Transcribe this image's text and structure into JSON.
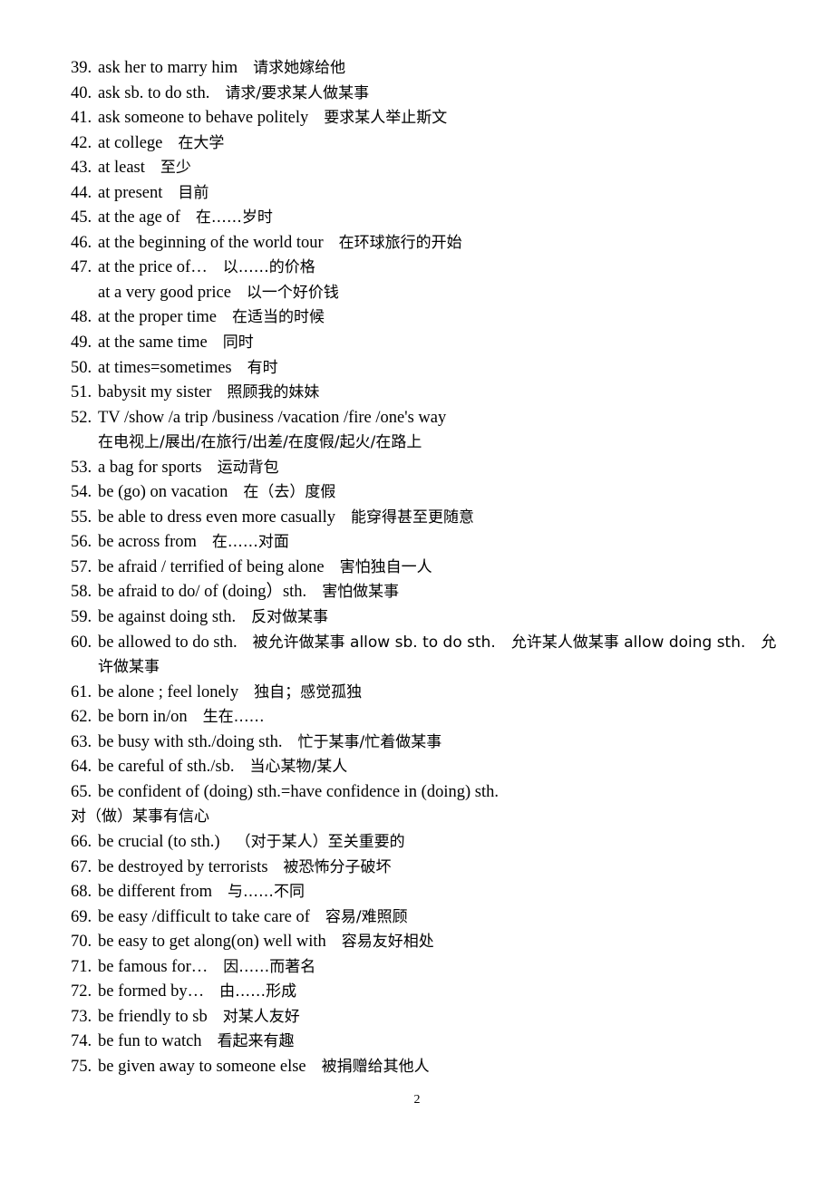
{
  "document": {
    "page_number": "2",
    "background_color": "#ffffff",
    "text_color": "#000000"
  },
  "entries": [
    {
      "type": "numbered",
      "num": "39.",
      "en": "ask her to marry him",
      "zh": "请求她嫁给他"
    },
    {
      "type": "numbered",
      "num": "40.",
      "en": "ask sb. to do sth.",
      "zh": "请求/要求某人做某事"
    },
    {
      "type": "numbered",
      "num": "41.",
      "en": "ask someone to behave politely",
      "zh": "要求某人举止斯文"
    },
    {
      "type": "numbered",
      "num": "42.",
      "en": "at college",
      "zh": "在大学"
    },
    {
      "type": "numbered",
      "num": "43.",
      "en": "at least",
      "zh": "至少"
    },
    {
      "type": "numbered",
      "num": "44.",
      "en": "at present",
      "zh": "目前"
    },
    {
      "type": "numbered",
      "num": "45.",
      "en": "at the age of",
      "zh": "在……岁时"
    },
    {
      "type": "numbered",
      "num": "46.",
      "en": "at the beginning of the world tour",
      "zh": "在环球旅行的开始"
    },
    {
      "type": "numbered",
      "num": "47.",
      "en": "at the price of…",
      "zh": "以……的价格"
    },
    {
      "type": "continuation",
      "num": "",
      "en": "at a very good price",
      "zh": "以一个好价钱"
    },
    {
      "type": "numbered",
      "num": "48.",
      "en": "at the proper time",
      "zh": "在适当的时候"
    },
    {
      "type": "numbered",
      "num": "49.",
      "en": "at the same time",
      "zh": "同时"
    },
    {
      "type": "numbered",
      "num": "50.",
      "en": "at times=sometimes",
      "zh": "有时"
    },
    {
      "type": "numbered",
      "num": "51.",
      "en": "babysit my sister",
      "zh": "照顾我的妹妹"
    },
    {
      "type": "numbered",
      "num": "52.",
      "en": "TV /show /a trip /business /vacation /fire /one's way",
      "zh": ""
    },
    {
      "type": "continuation",
      "num": "",
      "en": "",
      "zh": "在电视上/展出/在旅行/出差/在度假/起火/在路上"
    },
    {
      "type": "numbered",
      "num": "53.",
      "en": "a bag for sports",
      "zh": "运动背包"
    },
    {
      "type": "numbered",
      "num": "54.",
      "en": "be (go) on vacation",
      "zh": "在（去）度假"
    },
    {
      "type": "numbered",
      "num": "55.",
      "en": "be able to dress even more casually",
      "zh": "能穿得甚至更随意"
    },
    {
      "type": "numbered",
      "num": "56.",
      "en": "be across from",
      "zh": "在……对面"
    },
    {
      "type": "numbered",
      "num": "57.",
      "en": "be afraid / terrified of being alone",
      "zh": "害怕独自一人"
    },
    {
      "type": "numbered",
      "num": "58.",
      "en": "be afraid to do/ of (doing）sth.",
      "zh": "害怕做某事"
    },
    {
      "type": "numbered",
      "num": "59.",
      "en": "be against doing sth.",
      "zh": "反对做某事"
    },
    {
      "type": "numbered",
      "num": "60.",
      "en": "be allowed to do sth.",
      "zh": "被允许做某事 allow sb. to do sth.　允许某人做某事 allow doing sth.　允"
    },
    {
      "type": "continuation",
      "num": "",
      "en": "",
      "zh": "许做某事"
    },
    {
      "type": "numbered",
      "num": "61.",
      "en": "be alone ; feel lonely",
      "zh": "独自；感觉孤独"
    },
    {
      "type": "numbered",
      "num": "62.",
      "en": "be born in/on",
      "zh": "生在……"
    },
    {
      "type": "numbered",
      "num": "63.",
      "en": "be busy with sth./doing sth.",
      "zh": "忙于某事/忙着做某事"
    },
    {
      "type": "numbered",
      "num": "64.",
      "en": "be careful of sth./sb.",
      "zh": "当心某物/某人"
    },
    {
      "type": "numbered",
      "num": "65.",
      "en": "be confident of (doing) sth.=have confidence in (doing) sth.",
      "zh": ""
    },
    {
      "type": "continuation-flush",
      "num": "",
      "en": "",
      "zh": "对（做）某事有信心"
    },
    {
      "type": "numbered",
      "num": "66.",
      "en": "be crucial (to sth.)",
      "zh": "（对于某人）至关重要的"
    },
    {
      "type": "numbered",
      "num": "67.",
      "en": "be destroyed by terrorists",
      "zh": "被恐怖分子破坏"
    },
    {
      "type": "numbered",
      "num": "68.",
      "en": "be different from",
      "zh": "与……不同"
    },
    {
      "type": "numbered",
      "num": "69.",
      "en": "be easy /difficult to take care of",
      "zh": "容易/难照顾"
    },
    {
      "type": "numbered",
      "num": "70.",
      "en": "be easy to get along(on) well with",
      "zh": "容易友好相处"
    },
    {
      "type": "numbered",
      "num": "71.",
      "en": "be famous for…",
      "zh": "因……而著名"
    },
    {
      "type": "numbered",
      "num": "72.",
      "en": "be formed by…",
      "zh": "由……形成"
    },
    {
      "type": "numbered",
      "num": "73.",
      "en": "be friendly to sb",
      "zh": "对某人友好"
    },
    {
      "type": "numbered",
      "num": "74.",
      "en": "be fun to watch",
      "zh": "看起来有趣"
    },
    {
      "type": "numbered",
      "num": "75.",
      "en": "be given away to someone else",
      "zh": "被捐赠给其他人"
    }
  ]
}
